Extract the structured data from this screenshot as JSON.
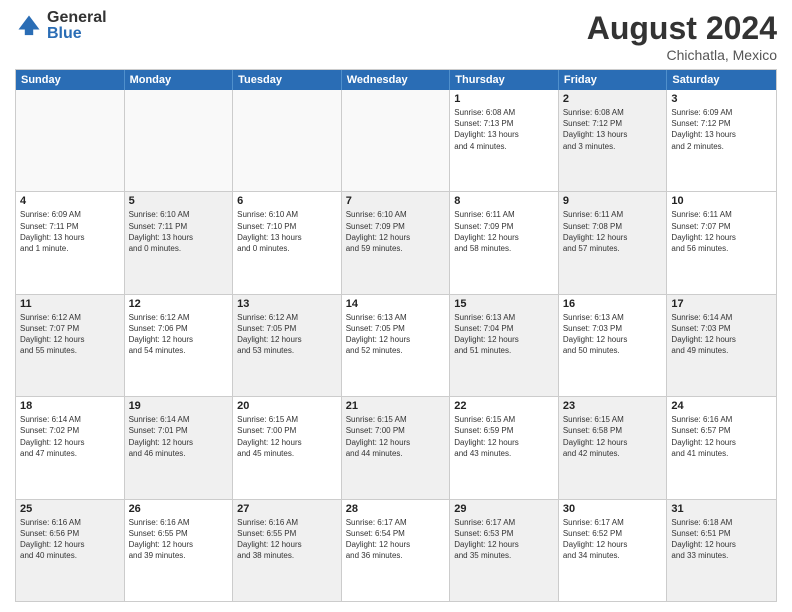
{
  "logo": {
    "general": "General",
    "blue": "Blue"
  },
  "title": "August 2024",
  "location": "Chichatla, Mexico",
  "days_of_week": [
    "Sunday",
    "Monday",
    "Tuesday",
    "Wednesday",
    "Thursday",
    "Friday",
    "Saturday"
  ],
  "weeks": [
    [
      {
        "day": "",
        "info": "",
        "empty": true
      },
      {
        "day": "",
        "info": "",
        "empty": true
      },
      {
        "day": "",
        "info": "",
        "empty": true
      },
      {
        "day": "",
        "info": "",
        "empty": true
      },
      {
        "day": "1",
        "info": "Sunrise: 6:08 AM\nSunset: 7:13 PM\nDaylight: 13 hours\nand 4 minutes.",
        "shaded": false
      },
      {
        "day": "2",
        "info": "Sunrise: 6:08 AM\nSunset: 7:12 PM\nDaylight: 13 hours\nand 3 minutes.",
        "shaded": true
      },
      {
        "day": "3",
        "info": "Sunrise: 6:09 AM\nSunset: 7:12 PM\nDaylight: 13 hours\nand 2 minutes.",
        "shaded": false
      }
    ],
    [
      {
        "day": "4",
        "info": "Sunrise: 6:09 AM\nSunset: 7:11 PM\nDaylight: 13 hours\nand 1 minute.",
        "shaded": false
      },
      {
        "day": "5",
        "info": "Sunrise: 6:10 AM\nSunset: 7:11 PM\nDaylight: 13 hours\nand 0 minutes.",
        "shaded": true
      },
      {
        "day": "6",
        "info": "Sunrise: 6:10 AM\nSunset: 7:10 PM\nDaylight: 13 hours\nand 0 minutes.",
        "shaded": false
      },
      {
        "day": "7",
        "info": "Sunrise: 6:10 AM\nSunset: 7:09 PM\nDaylight: 12 hours\nand 59 minutes.",
        "shaded": true
      },
      {
        "day": "8",
        "info": "Sunrise: 6:11 AM\nSunset: 7:09 PM\nDaylight: 12 hours\nand 58 minutes.",
        "shaded": false
      },
      {
        "day": "9",
        "info": "Sunrise: 6:11 AM\nSunset: 7:08 PM\nDaylight: 12 hours\nand 57 minutes.",
        "shaded": true
      },
      {
        "day": "10",
        "info": "Sunrise: 6:11 AM\nSunset: 7:07 PM\nDaylight: 12 hours\nand 56 minutes.",
        "shaded": false
      }
    ],
    [
      {
        "day": "11",
        "info": "Sunrise: 6:12 AM\nSunset: 7:07 PM\nDaylight: 12 hours\nand 55 minutes.",
        "shaded": true
      },
      {
        "day": "12",
        "info": "Sunrise: 6:12 AM\nSunset: 7:06 PM\nDaylight: 12 hours\nand 54 minutes.",
        "shaded": false
      },
      {
        "day": "13",
        "info": "Sunrise: 6:12 AM\nSunset: 7:05 PM\nDaylight: 12 hours\nand 53 minutes.",
        "shaded": true
      },
      {
        "day": "14",
        "info": "Sunrise: 6:13 AM\nSunset: 7:05 PM\nDaylight: 12 hours\nand 52 minutes.",
        "shaded": false
      },
      {
        "day": "15",
        "info": "Sunrise: 6:13 AM\nSunset: 7:04 PM\nDaylight: 12 hours\nand 51 minutes.",
        "shaded": true
      },
      {
        "day": "16",
        "info": "Sunrise: 6:13 AM\nSunset: 7:03 PM\nDaylight: 12 hours\nand 50 minutes.",
        "shaded": false
      },
      {
        "day": "17",
        "info": "Sunrise: 6:14 AM\nSunset: 7:03 PM\nDaylight: 12 hours\nand 49 minutes.",
        "shaded": true
      }
    ],
    [
      {
        "day": "18",
        "info": "Sunrise: 6:14 AM\nSunset: 7:02 PM\nDaylight: 12 hours\nand 47 minutes.",
        "shaded": false
      },
      {
        "day": "19",
        "info": "Sunrise: 6:14 AM\nSunset: 7:01 PM\nDaylight: 12 hours\nand 46 minutes.",
        "shaded": true
      },
      {
        "day": "20",
        "info": "Sunrise: 6:15 AM\nSunset: 7:00 PM\nDaylight: 12 hours\nand 45 minutes.",
        "shaded": false
      },
      {
        "day": "21",
        "info": "Sunrise: 6:15 AM\nSunset: 7:00 PM\nDaylight: 12 hours\nand 44 minutes.",
        "shaded": true
      },
      {
        "day": "22",
        "info": "Sunrise: 6:15 AM\nSunset: 6:59 PM\nDaylight: 12 hours\nand 43 minutes.",
        "shaded": false
      },
      {
        "day": "23",
        "info": "Sunrise: 6:15 AM\nSunset: 6:58 PM\nDaylight: 12 hours\nand 42 minutes.",
        "shaded": true
      },
      {
        "day": "24",
        "info": "Sunrise: 6:16 AM\nSunset: 6:57 PM\nDaylight: 12 hours\nand 41 minutes.",
        "shaded": false
      }
    ],
    [
      {
        "day": "25",
        "info": "Sunrise: 6:16 AM\nSunset: 6:56 PM\nDaylight: 12 hours\nand 40 minutes.",
        "shaded": true
      },
      {
        "day": "26",
        "info": "Sunrise: 6:16 AM\nSunset: 6:55 PM\nDaylight: 12 hours\nand 39 minutes.",
        "shaded": false
      },
      {
        "day": "27",
        "info": "Sunrise: 6:16 AM\nSunset: 6:55 PM\nDaylight: 12 hours\nand 38 minutes.",
        "shaded": true
      },
      {
        "day": "28",
        "info": "Sunrise: 6:17 AM\nSunset: 6:54 PM\nDaylight: 12 hours\nand 36 minutes.",
        "shaded": false
      },
      {
        "day": "29",
        "info": "Sunrise: 6:17 AM\nSunset: 6:53 PM\nDaylight: 12 hours\nand 35 minutes.",
        "shaded": true
      },
      {
        "day": "30",
        "info": "Sunrise: 6:17 AM\nSunset: 6:52 PM\nDaylight: 12 hours\nand 34 minutes.",
        "shaded": false
      },
      {
        "day": "31",
        "info": "Sunrise: 6:18 AM\nSunset: 6:51 PM\nDaylight: 12 hours\nand 33 minutes.",
        "shaded": true
      }
    ]
  ]
}
